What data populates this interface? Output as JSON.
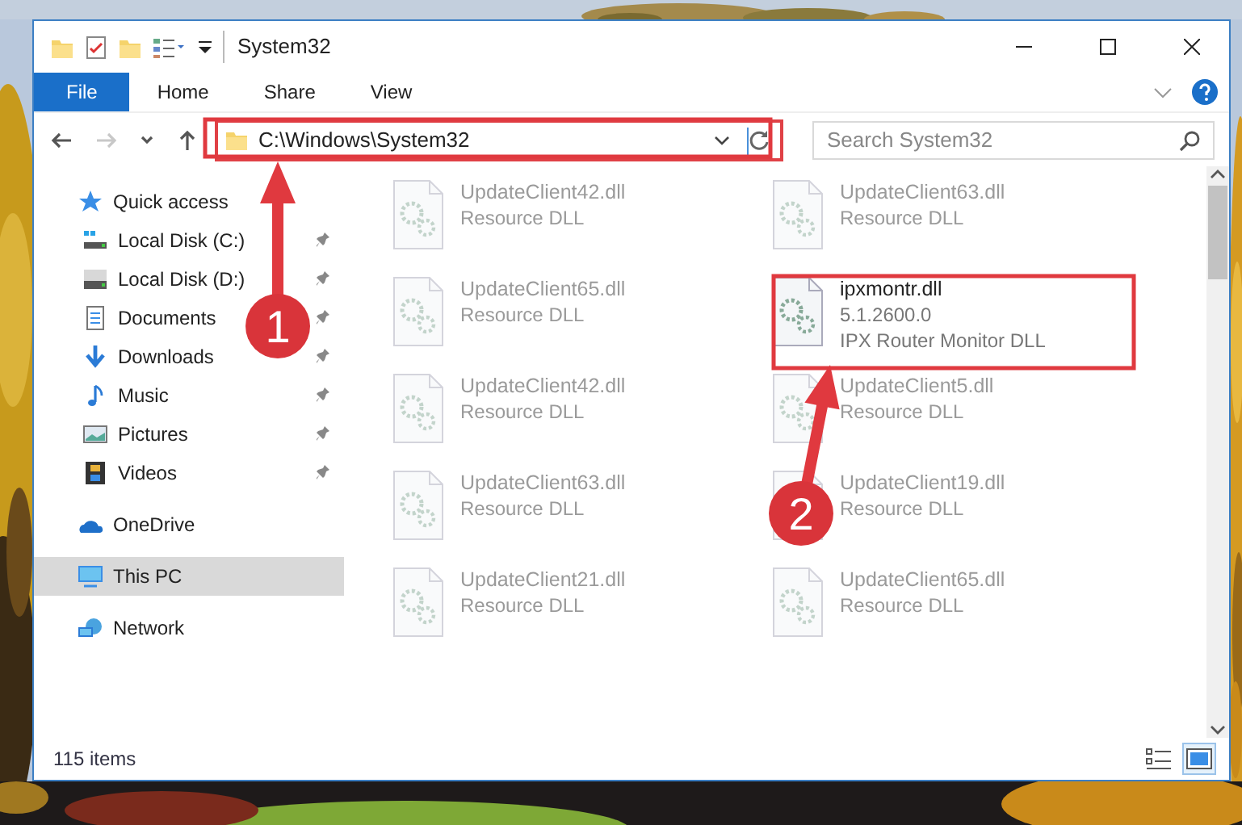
{
  "window": {
    "title": "System32"
  },
  "ribbon": {
    "tabs": [
      {
        "label": "File",
        "kind": "file",
        "selected": false
      },
      {
        "label": "Home",
        "kind": "tab",
        "selected": false
      },
      {
        "label": "Share",
        "kind": "tab",
        "selected": false
      },
      {
        "label": "View",
        "kind": "tab",
        "selected": false
      }
    ]
  },
  "navigation": {
    "back_disabled": false,
    "forward_disabled": true
  },
  "address_bar": {
    "path": "C:\\Windows\\System32"
  },
  "search": {
    "placeholder": "Search System32"
  },
  "sidebar": {
    "items": [
      {
        "label": "Quick access",
        "kind": "star",
        "selected": false,
        "children": [
          {
            "label": "Local Disk (C:)",
            "kind": "system-drive",
            "pinned": true,
            "selected": false
          },
          {
            "label": "Local Disk (D:)",
            "kind": "drive",
            "pinned": true,
            "selected": false
          },
          {
            "label": "Documents",
            "kind": "document",
            "pinned": true,
            "selected": false
          },
          {
            "label": "Downloads",
            "kind": "download",
            "pinned": true,
            "selected": false
          },
          {
            "label": "Music",
            "kind": "music",
            "pinned": true,
            "selected": false
          },
          {
            "label": "Pictures",
            "kind": "pictures",
            "pinned": true,
            "selected": false
          },
          {
            "label": "Videos",
            "kind": "videos",
            "pinned": true,
            "selected": false
          }
        ]
      },
      {
        "label": "OneDrive",
        "kind": "cloud",
        "selected": false
      },
      {
        "label": "This PC",
        "kind": "monitor",
        "selected": true
      },
      {
        "label": "Network",
        "kind": "network",
        "selected": false
      }
    ]
  },
  "files": [
    {
      "name": "UpdateClient42.dll",
      "lines": [
        "Resource DLL"
      ],
      "blurred": true
    },
    {
      "name": "UpdateClient63.dll",
      "lines": [
        "Resource DLL"
      ],
      "blurred": true
    },
    {
      "name": "UpdateClient65.dll",
      "lines": [
        "Resource DLL"
      ],
      "blurred": true
    },
    {
      "name": "ipxmontr.dll",
      "lines": [
        "5.1.2600.0",
        "IPX Router Monitor DLL"
      ],
      "blurred": false
    },
    {
      "name": "UpdateClient42.dll",
      "lines": [
        "Resource DLL"
      ],
      "blurred": true
    },
    {
      "name": "UpdateClient5.dll",
      "lines": [
        "Resource DLL"
      ],
      "blurred": true
    },
    {
      "name": "UpdateClient63.dll",
      "lines": [
        "Resource DLL"
      ],
      "blurred": true
    },
    {
      "name": "UpdateClient19.dll",
      "lines": [
        "Resource DLL"
      ],
      "blurred": true
    },
    {
      "name": "UpdateClient21.dll",
      "lines": [
        "Resource DLL"
      ],
      "blurred": true
    },
    {
      "name": "UpdateClient65.dll",
      "lines": [
        "Resource DLL"
      ],
      "blurred": true
    }
  ],
  "status_bar": {
    "item_count": "115 items",
    "views": [
      {
        "kind": "details",
        "selected": false
      },
      {
        "kind": "large-icons",
        "selected": true
      }
    ]
  },
  "annotations": [
    {
      "label": "1"
    },
    {
      "label": "2"
    }
  ]
}
